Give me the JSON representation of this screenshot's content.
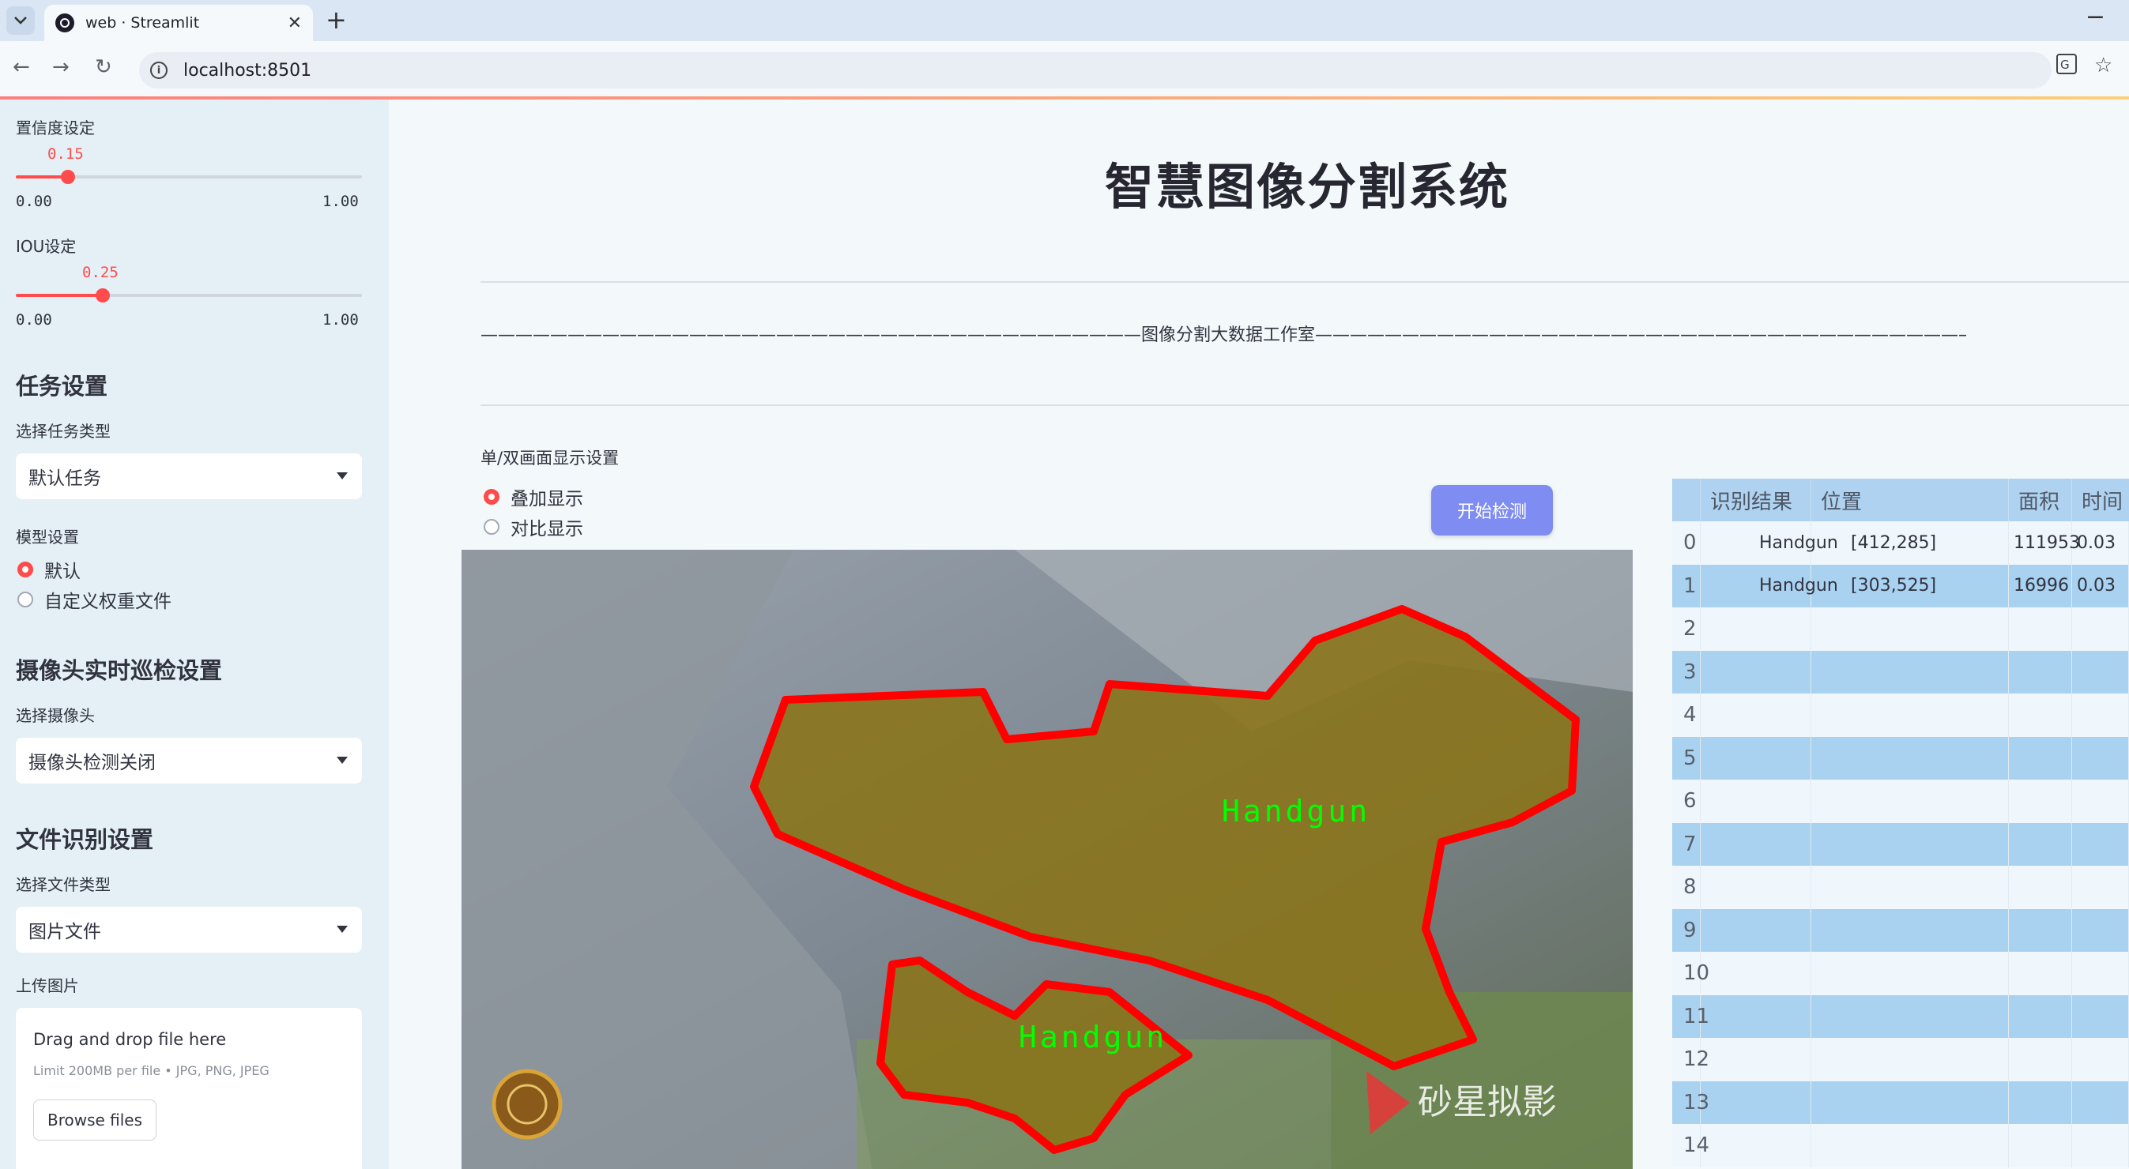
{
  "browser": {
    "tab_title": "web · Streamlit",
    "url": "localhost:8501"
  },
  "sidebar": {
    "conf_label": "置信度设定",
    "conf_value": "0.15",
    "conf_fraction": 0.15,
    "conf_min": "0.00",
    "conf_max": "1.00",
    "iou_label": "IOU设定",
    "iou_value": "0.25",
    "iou_fraction": 0.25,
    "iou_min": "0.00",
    "iou_max": "1.00",
    "task_heading": "任务设置",
    "task_type_label": "选择任务类型",
    "task_type_value": "默认任务",
    "model_label": "模型设置",
    "model_options": [
      "默认",
      "自定义权重文件"
    ],
    "camera_heading": "摄像头实时巡检设置",
    "camera_label": "选择摄像头",
    "camera_value": "摄像头检测关闭",
    "file_heading": "文件识别设置",
    "file_type_label": "选择文件类型",
    "file_type_value": "图片文件",
    "upload_label": "上传图片",
    "dropzone_title": "Drag and drop file here",
    "dropzone_sub": "Limit 200MB per file • JPG, PNG, JPEG",
    "browse_button": "Browse files"
  },
  "main": {
    "title": "智慧图像分割系统",
    "subtitle": "——————————————————————————————————————图像分割大数据工作室————————————————————————————————————————",
    "display_label": "单/双画面显示设置",
    "display_options": [
      "叠加显示",
      "对比显示"
    ],
    "start_button": "开始检测",
    "detection_labels": [
      "Handgun",
      "Handgun"
    ],
    "watermark_text": "砂星拟影"
  },
  "table": {
    "columns": [
      "",
      "识别结果",
      "位置",
      "面积",
      "时间"
    ],
    "rows": [
      {
        "index": "0",
        "result": "Handgun",
        "position": "[412,285]",
        "area": "111953",
        "time": "0.03"
      },
      {
        "index": "1",
        "result": "Handgun",
        "position": "[303,525]",
        "area": "16996",
        "time": "0.03"
      },
      {
        "index": "2",
        "result": "",
        "position": "",
        "area": "",
        "time": ""
      },
      {
        "index": "3",
        "result": "",
        "position": "",
        "area": "",
        "time": ""
      },
      {
        "index": "4",
        "result": "",
        "position": "",
        "area": "",
        "time": ""
      },
      {
        "index": "5",
        "result": "",
        "position": "",
        "area": "",
        "time": ""
      },
      {
        "index": "6",
        "result": "",
        "position": "",
        "area": "",
        "time": ""
      },
      {
        "index": "7",
        "result": "",
        "position": "",
        "area": "",
        "time": ""
      },
      {
        "index": "8",
        "result": "",
        "position": "",
        "area": "",
        "time": ""
      },
      {
        "index": "9",
        "result": "",
        "position": "",
        "area": "",
        "time": ""
      },
      {
        "index": "10",
        "result": "",
        "position": "",
        "area": "",
        "time": ""
      },
      {
        "index": "11",
        "result": "",
        "position": "",
        "area": "",
        "time": ""
      },
      {
        "index": "12",
        "result": "",
        "position": "",
        "area": "",
        "time": ""
      },
      {
        "index": "13",
        "result": "",
        "position": "",
        "area": "",
        "time": ""
      },
      {
        "index": "14",
        "result": "",
        "position": "",
        "area": "",
        "time": ""
      }
    ]
  },
  "colors": {
    "accent": "#ff4b4b",
    "button": "#7f8cf2",
    "mask_outline": "#ff0000",
    "label_text": "#00ff00"
  }
}
